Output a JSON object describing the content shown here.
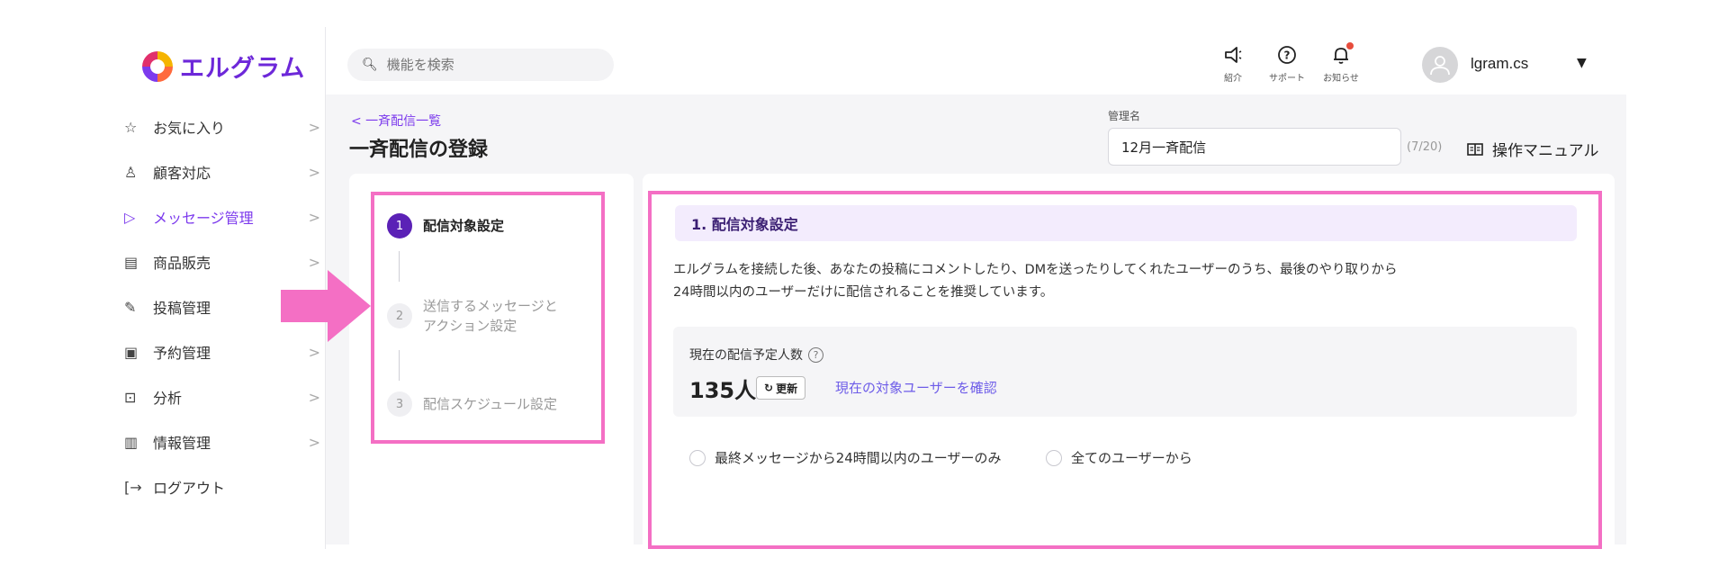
{
  "brand": {
    "name": "エルグラム"
  },
  "sidebar": {
    "items": [
      {
        "label": "お気に入り",
        "icon": "star-icon",
        "glyph": "☆",
        "active": false,
        "has_chevron": true
      },
      {
        "label": "顧客対応",
        "icon": "person-icon",
        "glyph": "♙",
        "active": false,
        "has_chevron": true
      },
      {
        "label": "メッセージ管理",
        "icon": "send-icon",
        "glyph": "▷",
        "active": true,
        "has_chevron": true
      },
      {
        "label": "商品販売",
        "icon": "store-icon",
        "glyph": "▤",
        "active": false,
        "has_chevron": true
      },
      {
        "label": "投稿管理",
        "icon": "edit-icon",
        "glyph": "✎",
        "active": false,
        "has_chevron": false
      },
      {
        "label": "予約管理",
        "icon": "calendar-icon",
        "glyph": "▣",
        "active": false,
        "has_chevron": true
      },
      {
        "label": "分析",
        "icon": "report-icon",
        "glyph": "⊡",
        "active": false,
        "has_chevron": true
      },
      {
        "label": "情報管理",
        "icon": "chart-icon",
        "glyph": "▥",
        "active": false,
        "has_chevron": true
      },
      {
        "label": "ログアウト",
        "icon": "logout-icon",
        "glyph": "[→",
        "active": false,
        "has_chevron": false
      }
    ],
    "chevron": ">"
  },
  "header": {
    "search_placeholder": "機能を検索",
    "intro_label": "紹介",
    "support_label": "サポート",
    "notice_label": "お知らせ",
    "username": "lgram.cs"
  },
  "page": {
    "breadcrumb": "< 一斉配信一覧",
    "title": "一斉配信の登録",
    "mgmt_label": "管理名",
    "mgmt_value": "12月一斉配信",
    "mgmt_count": "(7/20)",
    "manual_label": "操作マニュアル"
  },
  "steps": [
    {
      "num": "1",
      "label": "配信対象設定",
      "active": true
    },
    {
      "num": "2",
      "label": "送信するメッセージと\nアクション設定",
      "active": false
    },
    {
      "num": "3",
      "label": "配信スケジュール設定",
      "active": false
    }
  ],
  "section": {
    "heading": "1. 配信対象設定",
    "description": "エルグラムを接続した後、あなたの投稿にコメントしたり、DMを送ったりしてくれたユーザーのうち、最後のやり取りから24時間以内のユーザーだけに配信されることを推奨しています。",
    "count_label": "現在の配信予定人数",
    "count_value": "135人",
    "refresh_label": "更新",
    "check_link": "現在の対象ユーザーを確認",
    "radio_24h": "最終メッセージから24時間以内のユーザーのみ",
    "radio_all": "全てのユーザーから"
  },
  "colors": {
    "accent": "#7c3aed",
    "highlight": "#f46fc4",
    "step_active": "#5b21b6"
  }
}
